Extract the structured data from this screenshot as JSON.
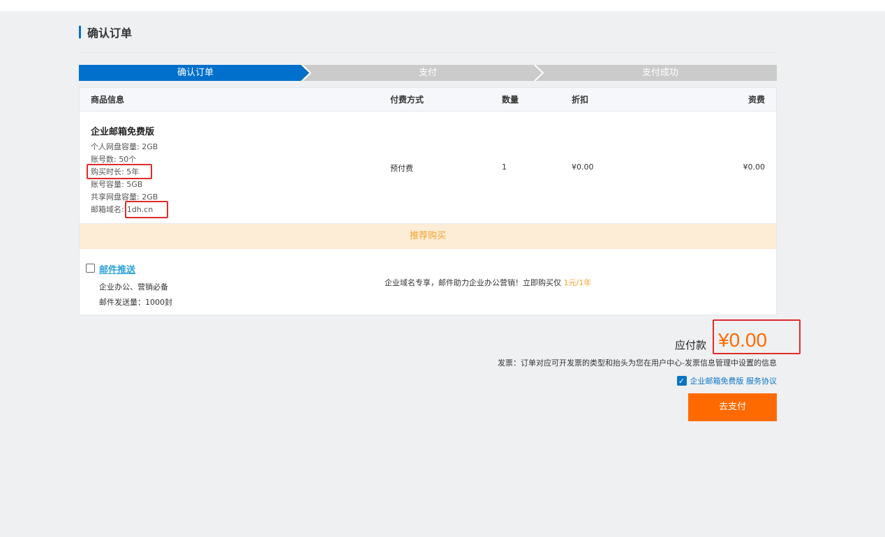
{
  "page": {
    "title": "确认订单"
  },
  "steps": [
    {
      "label": "确认订单",
      "active": true
    },
    {
      "label": "支付",
      "active": false
    },
    {
      "label": "支付成功",
      "active": false
    }
  ],
  "table": {
    "headers": {
      "product": "商品信息",
      "pay_method": "付费方式",
      "quantity": "数量",
      "discount": "折扣",
      "fee": "资费"
    },
    "product": {
      "name": "企业邮箱免费版",
      "specs": {
        "personal_disk": "个人网盘容量: 2GB",
        "accounts": "账号数: 50个",
        "duration": "购买时长: 5年",
        "account_capacity": "账号容量: 5GB",
        "shared_disk": "共享网盘容量: 2GB",
        "domain_label": "邮箱域名:",
        "domain_value": "1dh.cn"
      },
      "pay_method": "预付费",
      "quantity": "1",
      "discount": "¥0.00",
      "fee": "¥0.00"
    },
    "recommend_label": "推荐购买",
    "addon": {
      "name": "邮件推送",
      "desc1": "企业办公、营销必备",
      "desc2": "邮件发送量：1000封",
      "promo_text": "企业域名专享，邮件助力企业办公营销！立即购买仅",
      "promo_price": "1元/1年"
    }
  },
  "summary": {
    "pay_label": "应付款",
    "amount": "¥0.00",
    "invoice_note": "发票：订单对应可开发票的类型和抬头为您在用户中心-发票信息管理中设置的信息",
    "agree_text": "企业邮箱免费版 服务协议",
    "pay_button": "去支付"
  },
  "colors": {
    "accent": "#0070cc",
    "orange": "#ff6a00",
    "highlight": "#e02b2b"
  }
}
